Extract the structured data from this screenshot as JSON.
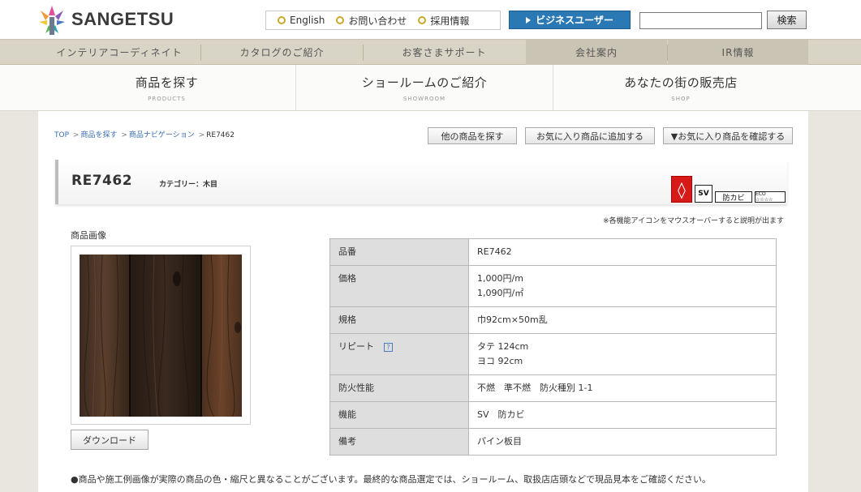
{
  "header": {
    "logo_text": "SANGETSU",
    "links": [
      "English",
      "お問い合わせ",
      "採用情報"
    ],
    "business_button": "ビジネスユーザー",
    "search_value": "",
    "search_button": "検索",
    "accent_color": "#2a79b5"
  },
  "global_nav": [
    "インテリアコーディネイト",
    "カタログのご紹介",
    "お客さまサポート",
    "会社案内",
    "IR情報"
  ],
  "main_nav": [
    {
      "jp": "商品を探す",
      "en": "PRODUCTS"
    },
    {
      "jp": "ショールームのご紹介",
      "en": "SHOWROOM"
    },
    {
      "jp": "あなたの街の販売店",
      "en": "SHOP"
    }
  ],
  "breadcrumb": {
    "items": [
      "TOP",
      "商品を探す",
      "商品ナビゲーション"
    ],
    "current": "RE7462"
  },
  "toolbar": {
    "other_products": "他の商品を探す",
    "add_favorite": "お気に入り商品に追加する",
    "check_favorite": "▼お気に入り商品を確認する"
  },
  "product": {
    "code": "RE7462",
    "category": "カテゴリー：木目",
    "icons": {
      "fire": "fire-retardant-icon",
      "sv": "SV",
      "mold": "防カビ",
      "eco": "ECO ☆☆☆☆"
    },
    "icon_note": "※各機能アイコンをマウスオーバーすると説明が出ます",
    "image_label": "商品画像",
    "download_button": "ダウンロード"
  },
  "specs": [
    {
      "label": "品番",
      "values": [
        "RE7462"
      ]
    },
    {
      "label": "価格",
      "values": [
        "1,000円/m",
        "1,090円/㎡"
      ]
    },
    {
      "label": "規格",
      "values": [
        "巾92cm×50m乱"
      ]
    },
    {
      "label": "リピート",
      "values": [
        "タテ 124cm",
        "ヨコ 92cm"
      ],
      "help": "?"
    },
    {
      "label": "防火性能",
      "values": [
        "不燃　準不燃　防火種別 1-1"
      ]
    },
    {
      "label": "機能",
      "values": [
        "SV　防カビ"
      ]
    },
    {
      "label": "備考",
      "values": [
        "パイン板目"
      ]
    }
  ],
  "footer_note": "●商品や施工例画像が実際の商品の色・縮尺と異なることがございます。最終的な商品選定では、ショールーム、取扱店店頭などで現品見本をご確認ください。"
}
